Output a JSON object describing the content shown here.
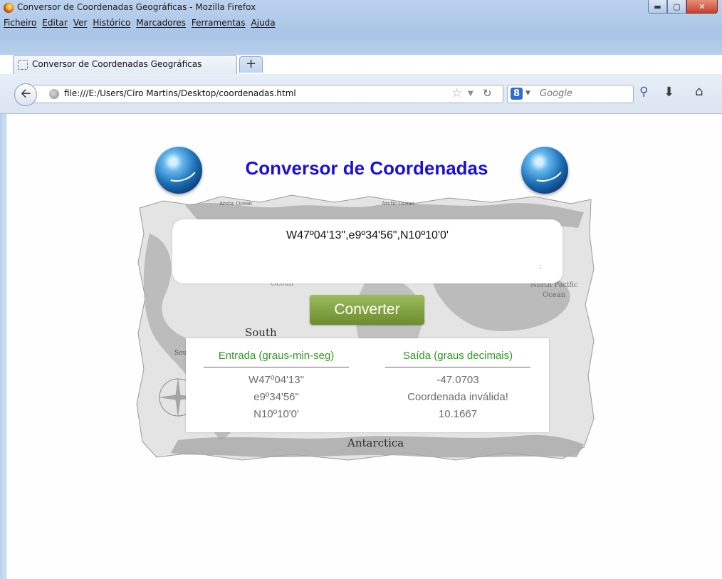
{
  "window": {
    "title": "Conversor de Coordenadas Geográficas - Mozilla Firefox",
    "minimize_icon": "minimize-icon",
    "maximize_icon": "maximize-icon",
    "close_icon": "close-icon"
  },
  "menu": {
    "items": [
      "Ficheiro",
      "Editar",
      "Ver",
      "Histórico",
      "Marcadores",
      "Ferramentas",
      "Ajuda"
    ]
  },
  "tabs": {
    "active_label": "Conversor de Coordenadas Geográficas",
    "new_tab_label": "+"
  },
  "nav": {
    "url": "file:///E:/Users/Ciro Martins/Desktop/coordenadas.html",
    "search_placeholder": "Google",
    "search_engine_letter": "8"
  },
  "page": {
    "title": "Conversor de Coordenadas",
    "map_labels": {
      "arctic_1": "Arctic Ocean",
      "arctic_2": "Arctic Ocean",
      "ocean": "Ocean",
      "north_pacific_1": "North Pacific",
      "north_pacific_2": "Ocean",
      "south": "South",
      "so": "Sou",
      "antarctica": "Antarctica"
    },
    "input_value": "W47º04'13\",e9º34'56\",N10º10'0'",
    "convert_label": "Converter",
    "results": {
      "input_header": "Entrada (graus-min-seg)",
      "output_header": "Saída (graus decimais)",
      "rows": [
        {
          "in": "W47º04'13\"",
          "out": "-47.0703"
        },
        {
          "in": "e9º34'56\"",
          "out": "Coordenada inválida!"
        },
        {
          "in": "N10º10'0'",
          "out": "10.1667"
        }
      ]
    }
  },
  "colors": {
    "title_blue": "#1a10d8",
    "header_green": "#2a9a1e",
    "button_green": "#7a9c3a"
  }
}
